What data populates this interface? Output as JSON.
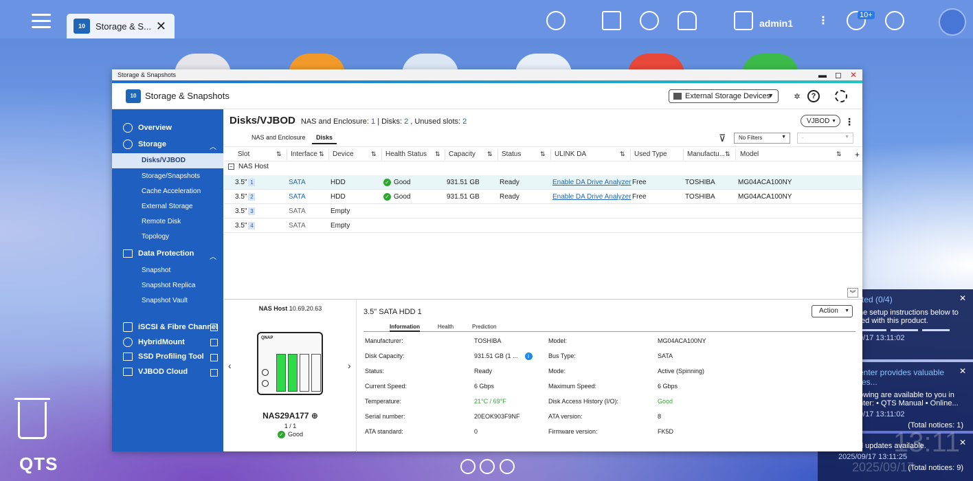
{
  "topbar": {
    "tab_label": "Storage & S...",
    "user": "admin1",
    "badge": "10+"
  },
  "desktop": {
    "os_label": "QTS",
    "big_time": "13:11",
    "big_date": "2025/09/17"
  },
  "notifications": [
    {
      "title": "rted (0/4)",
      "body": "he setup instructions below to\nted with this product.",
      "time": "9/17 13:11:02",
      "total": ""
    },
    {
      "title": "enter provides valuable res...",
      "body": "owing are available to you in\nnter: • QTS Manual • Online...",
      "time": "9/17 13:11:02",
      "total": "(Total notices: 1)"
    },
    {
      "title": "",
      "body": "d updates available.",
      "time": "2025/09/17 13:11:25",
      "total": "(Total notices: 9)"
    }
  ],
  "window": {
    "title": "Storage & Snapshots",
    "app_name": "Storage & Snapshots",
    "ext_device": "External Storage Devices"
  },
  "sidebar": {
    "overview": "Overview",
    "storage": "Storage",
    "storage_items": [
      "Disks/VJBOD",
      "Storage/Snapshots",
      "Cache Acceleration",
      "External Storage",
      "Remote Disk",
      "Topology"
    ],
    "data_protection": "Data Protection",
    "dp_items": [
      "Snapshot",
      "Snapshot Replica",
      "Snapshot Vault"
    ],
    "iscsi": "iSCSI & Fibre Channel",
    "hybridmount": "HybridMount",
    "ssd": "SSD Profiling Tool",
    "vjbod_cloud": "VJBOD Cloud"
  },
  "main": {
    "title": "Disks/VJBOD",
    "nas_enclosure_label": "NAS and Enclosure:",
    "nas_enclosure_count": "1",
    "disks_label": "| Disks:",
    "disks_count": "2",
    "unused_label": ", Unused slots:",
    "unused_count": "2",
    "vjbod_btn": "VJBOD",
    "subtab1": "NAS and Enclosure",
    "subtab2": "Disks",
    "filter": "No Filters",
    "filter2": "-",
    "columns": [
      "Slot",
      "Interface",
      "Device",
      "Health Status",
      "Capacity",
      "Status",
      "ULINK DA",
      "Used Type",
      "Manufactu...",
      "Model"
    ],
    "group": "NAS Host",
    "rows": [
      {
        "slot": "3.5\"",
        "num": "1",
        "iface": "SATA",
        "device": "HDD",
        "health": "Good",
        "capacity": "931.51 GB",
        "status": "Ready",
        "ulink": "Enable DA Drive Analyzer",
        "used": "Free",
        "manu": "TOSHIBA",
        "model": "MG04ACA100NY"
      },
      {
        "slot": "3.5\"",
        "num": "2",
        "iface": "SATA",
        "device": "HDD",
        "health": "Good",
        "capacity": "931.51 GB",
        "status": "Ready",
        "ulink": "Enable DA Drive Analyzer",
        "used": "Free",
        "manu": "TOSHIBA",
        "model": "MG04ACA100NY"
      },
      {
        "slot": "3.5\"",
        "num": "3",
        "iface": "SATA",
        "device": "Empty"
      },
      {
        "slot": "3.5\"",
        "num": "4",
        "iface": "SATA",
        "device": "Empty"
      }
    ]
  },
  "detail": {
    "nas_host_label": "NAS Host",
    "nas_ip": "10.69.20.63",
    "nas_name": "NAS29A177",
    "page": "1 / 1",
    "status": "Good",
    "brand": "QNAP",
    "disk_title": "3.5\" SATA HDD 1",
    "action": "Action",
    "tabs": [
      "Information",
      "Health",
      "Prediction"
    ],
    "left": [
      {
        "k": "Manufacturer:",
        "v": "TOSHIBA"
      },
      {
        "k": "Disk Capacity:",
        "v": "931.51 GB (1 ..."
      },
      {
        "k": "Status:",
        "v": "Ready"
      },
      {
        "k": "Current Speed:",
        "v": "6 Gbps"
      },
      {
        "k": "Temperature:",
        "v": "21°C / 69°F"
      },
      {
        "k": "Serial number:",
        "v": "20EOK903F9NF"
      },
      {
        "k": "ATA standard:",
        "v": "0"
      }
    ],
    "right": [
      {
        "k": "Model:",
        "v": "MG04ACA100NY"
      },
      {
        "k": "Bus Type:",
        "v": "SATA"
      },
      {
        "k": "Mode:",
        "v": "Active (Spinning)"
      },
      {
        "k": "Maximum Speed:",
        "v": "6 Gbps"
      },
      {
        "k": "Disk Access History (I/O):",
        "v": "Good"
      },
      {
        "k": "ATA version:",
        "v": "8"
      },
      {
        "k": "Firmware version:",
        "v": "FK5D"
      }
    ]
  },
  "colors": {
    "accent": "#1f66b8",
    "sidebar": "#1f5fbf",
    "good": "#2ea52e",
    "close": "#e22222"
  }
}
